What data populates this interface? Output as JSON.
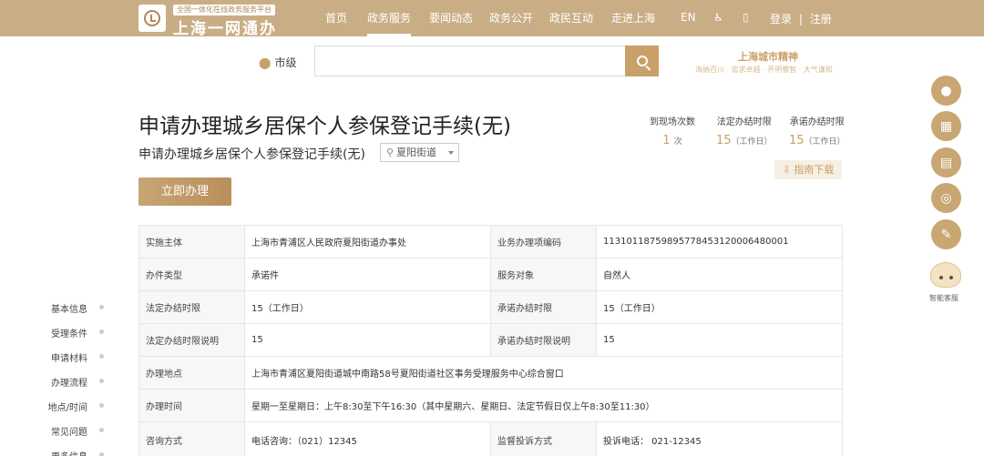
{
  "header": {
    "tagline": "全国一体化在线政务服务平台",
    "brand": "上海一网通办",
    "nav": [
      "首页",
      "政务服务",
      "要闻动态",
      "政务公开",
      "政民互动",
      "走进上海"
    ],
    "active_nav": "政务服务",
    "lang": "EN",
    "login": "登录",
    "divider": "|",
    "register": "注册"
  },
  "search": {
    "location": "市级",
    "value": "",
    "placeholder": ""
  },
  "city": {
    "title": "上海城市精神",
    "subtitle": "海纳百川 · 追求卓越 · 开明睿智 · 大气谦和"
  },
  "page": {
    "title": "申请办理城乡居保个人参保登记手续(无)",
    "subtitle": "申请办理城乡居保个人参保登记手续(无)",
    "street": "夏阳街道",
    "apply_label": "立即办理",
    "guide_label": "指南下载"
  },
  "stats": [
    {
      "label": "到现场次数",
      "value": "1",
      "unit": "次"
    },
    {
      "label": "法定办结时限",
      "value": "15",
      "unit": "（工作日）"
    },
    {
      "label": "承诺办结时限",
      "value": "15",
      "unit": "（工作日）"
    }
  ],
  "table": {
    "r1": {
      "k1": "实施主体",
      "v1": "上海市青浦区人民政府夏阳街道办事处",
      "k2": "业务办理项编码",
      "v2": "11310118759895778453120006480001"
    },
    "r2": {
      "k1": "办件类型",
      "v1": "承诺件",
      "k2": "服务对象",
      "v2": "自然人"
    },
    "r3": {
      "k1": "法定办结时限",
      "v1": "15（工作日）",
      "k2": "承诺办结时限",
      "v2": "15（工作日）"
    },
    "r4": {
      "k1": "法定办结时限说明",
      "v1": "15",
      "k2": "承诺办结时限说明",
      "v2": "15"
    },
    "r5": {
      "k1": "办理地点",
      "v1": "上海市青浦区夏阳街道城中南路58号夏阳街道社区事务受理服务中心综合窗口"
    },
    "r6": {
      "k1": "办理时间",
      "v1": "星期一至星期日：上午8:30至下午16:30（其中星期六、星期日、法定节假日仅上午8:30至11:30）"
    },
    "r7": {
      "k1": "咨询方式",
      "v1": "电话咨询：（021）12345",
      "k2": "监督投诉方式",
      "v2": "投诉电话： 021-12345"
    }
  },
  "side_nav": [
    "基本信息",
    "受理条件",
    "申请材料",
    "办理流程",
    "地点/时间",
    "常见问题",
    "更多信息"
  ],
  "robot_label": "智能客服",
  "icons": {
    "user": "user-icon",
    "calendar": "calendar-icon",
    "doc": "document-icon",
    "search": "search-icon",
    "edit": "edit-icon"
  },
  "colors": {
    "header": "#c9ae85",
    "accent": "#c9a06a"
  }
}
